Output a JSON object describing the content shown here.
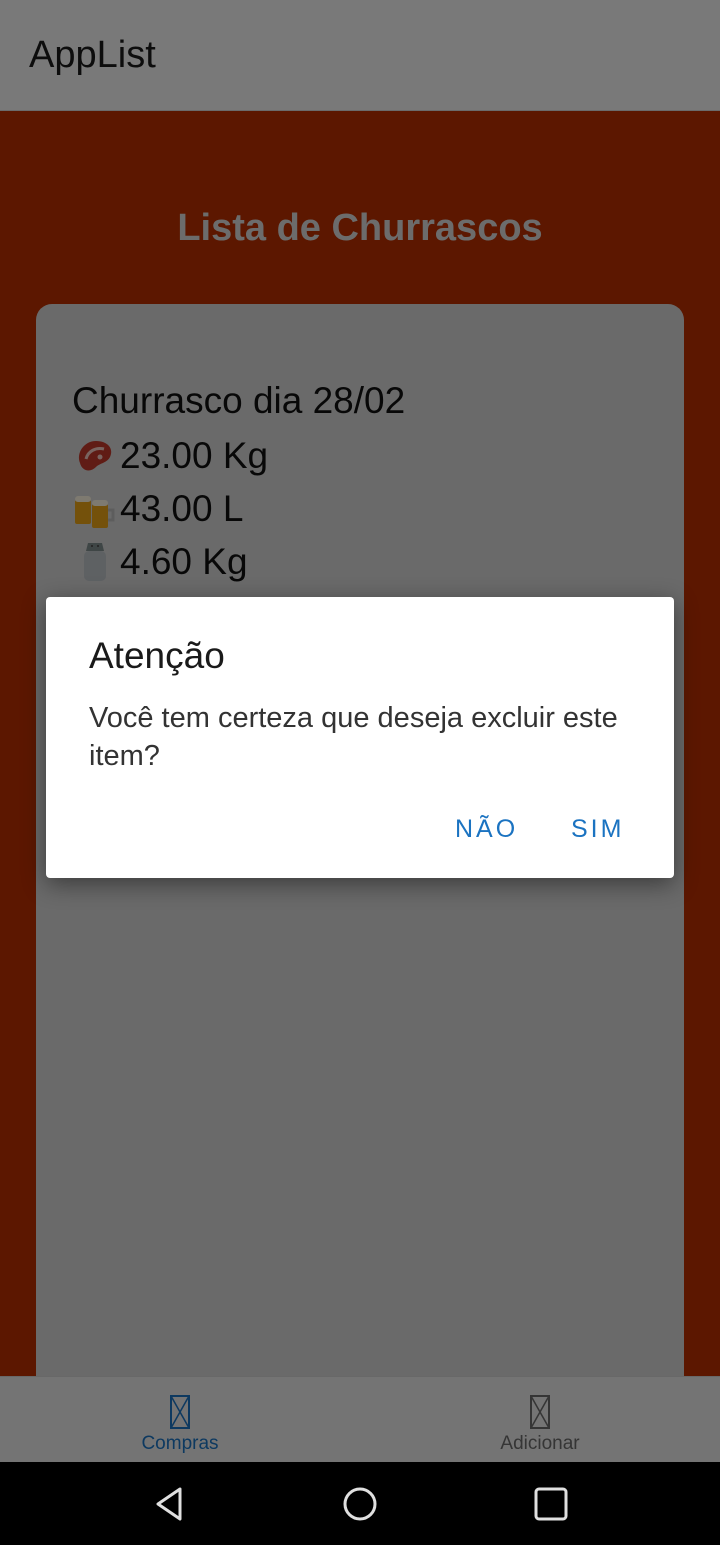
{
  "app": {
    "title": "AppList"
  },
  "page": {
    "title": "Lista de Churrascos"
  },
  "card": {
    "title": "Churrasco dia 28/02",
    "items": [
      {
        "icon": "meat-icon",
        "value": "23.00 Kg"
      },
      {
        "icon": "beer-icon",
        "value": "43.00 L"
      },
      {
        "icon": "salt-shaker-icon",
        "value": "4.60 Kg"
      }
    ]
  },
  "bottom_nav": {
    "items": [
      {
        "label": "Compras",
        "icon": "missing-glyph-icon",
        "active": true
      },
      {
        "label": "Adicionar",
        "icon": "missing-glyph-icon",
        "active": false
      }
    ],
    "active_color": "#1b73c1",
    "inactive_color": "#6b6b6b"
  },
  "dialog": {
    "title": "Atenção",
    "message": "Você tem certeza que deseja excluir este item?",
    "negative_label": "Não",
    "positive_label": "Sim",
    "button_color": "#1b73c1"
  },
  "colors": {
    "content_background": "#b82e00",
    "card_background": "#d4d4d4",
    "appbar_background": "#f2f2f2"
  }
}
